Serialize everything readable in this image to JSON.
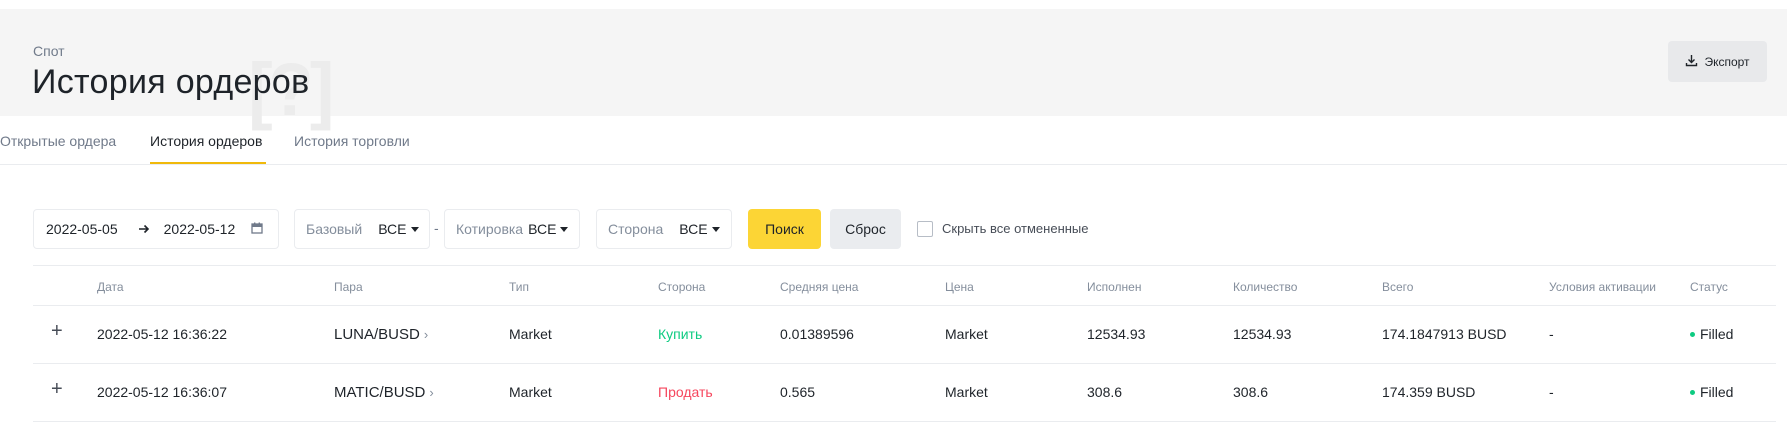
{
  "header": {
    "breadcrumb": "Спот",
    "title": "История ордеров",
    "export_label": "Экспорт"
  },
  "tabs": [
    {
      "label": "Открытые ордера",
      "active": false
    },
    {
      "label": "История ордеров",
      "active": true
    },
    {
      "label": "История торговли",
      "active": false
    }
  ],
  "filters": {
    "date_from": "2022-05-05",
    "date_to": "2022-05-12",
    "base_label": "Базовый",
    "base_value": "ВСЕ",
    "separator": "-",
    "quote_label": "Котировка",
    "quote_value": "ВСЕ",
    "side_label": "Сторона",
    "side_value": "ВСЕ",
    "search_label": "Поиск",
    "reset_label": "Сброс",
    "hide_cancelled_label": "Скрыть все отмененные",
    "hide_cancelled_checked": false
  },
  "table": {
    "columns": [
      "Дата",
      "Пара",
      "Тип",
      "Сторона",
      "Средняя цена",
      "Цена",
      "Исполнен",
      "Количество",
      "Всего",
      "Условия активации",
      "Статус"
    ],
    "rows": [
      {
        "date": "2022-05-12 16:36:22",
        "pair": "LUNA/BUSD",
        "type": "Market",
        "side": "Купить",
        "avg_price": "0.01389596",
        "price": "Market",
        "filled": "12534.93",
        "amount": "12534.93",
        "total": "174.1847913 BUSD",
        "trigger": "-",
        "status": "Filled"
      },
      {
        "date": "2022-05-12 16:36:07",
        "pair": "MATIC/BUSD",
        "type": "Market",
        "side": "Продать",
        "avg_price": "0.565",
        "price": "Market",
        "filled": "308.6",
        "amount": "308.6",
        "total": "174.359 BUSD",
        "trigger": "-",
        "status": "Filled"
      }
    ]
  },
  "colors": {
    "accent": "#fcd535",
    "buy": "#0ecb81",
    "sell": "#f6465d",
    "tab_underline": "#f0b90b"
  }
}
